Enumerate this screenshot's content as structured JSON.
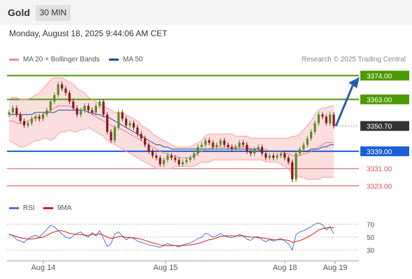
{
  "header": {
    "title": "Gold",
    "timeframe": "30 MIN"
  },
  "datetime": "Monday, August 18, 2025 9:44:06 AM CET",
  "legend": {
    "bollinger_label": "MA 20 + Bollinger Bands",
    "ma50_label": "MA 50",
    "credit": "Research © 2025 Trading Central"
  },
  "colors": {
    "resistance": "#4c9a00",
    "support": "#1a5fd6",
    "pivot_line": "#e05050",
    "last_price": "#333333",
    "bull_candle": "#5a8a2a",
    "bear_candle": "#8a1a1a",
    "bollinger": "#f8a0a0",
    "ma50": "#1f4e96",
    "arrow": "#2a5fb0",
    "rsi": "#4a73d9",
    "rsi_ma": "#d81b1b"
  },
  "chart_data": [
    {
      "type": "candlestick",
      "x_tick_labels": [
        "Aug 14",
        "Aug 15",
        "Aug 18",
        "Aug 19"
      ],
      "ylim": [
        3318,
        3378
      ],
      "levels": [
        {
          "label": "3374.00",
          "value": 3374.0,
          "kind": "resistance"
        },
        {
          "label": "3363.00",
          "value": 3363.0,
          "kind": "resistance"
        },
        {
          "label": "3350.70",
          "value": 3350.7,
          "kind": "last"
        },
        {
          "label": "3339.00",
          "value": 3339.0,
          "kind": "support"
        },
        {
          "label": "3331.00",
          "value": 3331.0,
          "kind": "pivot"
        },
        {
          "label": "3323.00",
          "value": 3323.0,
          "kind": "pivot"
        }
      ],
      "close": [
        3357,
        3359,
        3356,
        3353,
        3351,
        3352,
        3354,
        3355,
        3354,
        3356,
        3358,
        3362,
        3365,
        3370,
        3368,
        3366,
        3362,
        3359,
        3356,
        3358,
        3360,
        3358,
        3357,
        3360,
        3362,
        3356,
        3348,
        3344,
        3350,
        3357,
        3354,
        3351,
        3352,
        3350,
        3347,
        3345,
        3342,
        3339,
        3337,
        3336,
        3333,
        3335,
        3337,
        3336,
        3335,
        3333,
        3334,
        3335,
        3336,
        3338,
        3341,
        3342,
        3344,
        3343,
        3341,
        3342,
        3344,
        3342,
        3341,
        3340,
        3341,
        3343,
        3342,
        3339,
        3338,
        3340,
        3341,
        3338,
        3336,
        3337,
        3336,
        3337,
        3338,
        3336,
        3334,
        3326,
        3338,
        3340,
        3342,
        3345,
        3348,
        3352,
        3356,
        3355,
        3352,
        3356,
        3350.7
      ],
      "ma20": [
        3353,
        3353,
        3352,
        3352,
        3352,
        3353,
        3354,
        3355,
        3355,
        3356,
        3357,
        3358,
        3359,
        3360,
        3360,
        3360,
        3360,
        3359,
        3358,
        3358,
        3358,
        3357,
        3356,
        3355,
        3354,
        3353,
        3352,
        3351,
        3350,
        3350,
        3349,
        3348,
        3347,
        3346,
        3345,
        3344,
        3343,
        3342,
        3341,
        3340,
        3339,
        3338,
        3338,
        3337,
        3337,
        3336,
        3336,
        3336,
        3336,
        3337,
        3338,
        3339,
        3340,
        3340,
        3341,
        3341,
        3341,
        3341,
        3341,
        3341,
        3341,
        3341,
        3341,
        3341,
        3340,
        3340,
        3340,
        3340,
        3340,
        3339,
        3339,
        3339,
        3339,
        3338,
        3338,
        3337,
        3337,
        3337,
        3338,
        3338,
        3339,
        3340,
        3341,
        3342,
        3343,
        3343,
        3343
      ],
      "ma50": [
        3356,
        3356,
        3356,
        3356,
        3356,
        3356,
        3356,
        3357,
        3357,
        3357,
        3357,
        3357,
        3357,
        3358,
        3358,
        3358,
        3358,
        3358,
        3358,
        3358,
        3358,
        3357,
        3357,
        3356,
        3356,
        3355,
        3355,
        3354,
        3353,
        3352,
        3351,
        3350,
        3349,
        3348,
        3347,
        3346,
        3345,
        3344,
        3343,
        3342,
        3342,
        3341,
        3341,
        3340,
        3340,
        3340,
        3340,
        3340,
        3340,
        3340,
        3340,
        3340,
        3340,
        3340,
        3340,
        3340,
        3340,
        3340,
        3340,
        3340,
        3340,
        3340,
        3340,
        3340,
        3340,
        3340,
        3340,
        3339,
        3339,
        3339,
        3339,
        3339,
        3339,
        3339,
        3339,
        3339,
        3339,
        3339,
        3339,
        3339,
        3340,
        3340,
        3340,
        3341,
        3341,
        3342,
        3342
      ],
      "bb_upper": [
        3363,
        3364,
        3364,
        3363,
        3363,
        3363,
        3364,
        3365,
        3366,
        3368,
        3370,
        3372,
        3373,
        3373,
        3373,
        3372,
        3371,
        3370,
        3368,
        3367,
        3366,
        3364,
        3363,
        3362,
        3361,
        3360,
        3359,
        3358,
        3357,
        3357,
        3357,
        3356,
        3355,
        3354,
        3353,
        3351,
        3350,
        3349,
        3347,
        3346,
        3345,
        3344,
        3343,
        3342,
        3341,
        3341,
        3341,
        3341,
        3341,
        3342,
        3343,
        3344,
        3346,
        3347,
        3347,
        3347,
        3347,
        3347,
        3347,
        3347,
        3346,
        3346,
        3346,
        3346,
        3345,
        3345,
        3345,
        3345,
        3345,
        3345,
        3345,
        3345,
        3345,
        3345,
        3345,
        3346,
        3346,
        3347,
        3349,
        3351,
        3353,
        3356,
        3358,
        3359,
        3359,
        3360,
        3360
      ],
      "bb_lower": [
        3344,
        3343,
        3342,
        3341,
        3341,
        3342,
        3343,
        3344,
        3344,
        3345,
        3345,
        3344,
        3345,
        3347,
        3348,
        3348,
        3349,
        3348,
        3348,
        3349,
        3349,
        3350,
        3349,
        3348,
        3347,
        3346,
        3344,
        3343,
        3342,
        3341,
        3340,
        3339,
        3338,
        3337,
        3336,
        3335,
        3334,
        3333,
        3332,
        3331,
        3331,
        3331,
        3331,
        3331,
        3332,
        3332,
        3332,
        3332,
        3332,
        3332,
        3333,
        3334,
        3334,
        3334,
        3335,
        3335,
        3335,
        3335,
        3335,
        3335,
        3335,
        3335,
        3335,
        3335,
        3335,
        3335,
        3335,
        3335,
        3334,
        3334,
        3334,
        3334,
        3333,
        3332,
        3331,
        3328,
        3328,
        3327,
        3327,
        3326,
        3326,
        3326,
        3326,
        3327,
        3327,
        3327,
        3327
      ]
    },
    {
      "type": "line",
      "ylim": [
        20,
        80
      ],
      "y_tick_labels": [
        "70",
        "50",
        "30"
      ],
      "ref_levels": [
        70,
        50,
        30
      ],
      "series": [
        {
          "name": "RSI",
          "values": [
            55,
            52,
            46,
            44,
            42,
            47,
            51,
            53,
            50,
            56,
            62,
            68,
            66,
            60,
            55,
            50,
            48,
            52,
            56,
            58,
            53,
            50,
            57,
            52,
            60,
            48,
            36,
            40,
            55,
            58,
            52,
            46,
            50,
            48,
            44,
            42,
            40,
            38,
            37,
            36,
            34,
            38,
            40,
            38,
            37,
            35,
            38,
            40,
            41,
            44,
            48,
            50,
            56,
            54,
            50,
            52,
            56,
            52,
            50,
            49,
            51,
            54,
            52,
            47,
            45,
            50,
            51,
            46,
            43,
            46,
            44,
            46,
            48,
            44,
            40,
            30,
            54,
            58,
            60,
            63,
            66,
            70,
            72,
            69,
            61,
            66,
            55
          ]
        },
        {
          "name": "9MA",
          "values": [
            54,
            53,
            51,
            49,
            48,
            47,
            47,
            48,
            49,
            50,
            53,
            56,
            58,
            60,
            60,
            58,
            56,
            55,
            54,
            54,
            53,
            53,
            54,
            54,
            55,
            53,
            50,
            48,
            49,
            51,
            51,
            50,
            49,
            49,
            48,
            47,
            45,
            43,
            41,
            40,
            38,
            37,
            37,
            37,
            37,
            37,
            37,
            38,
            38,
            39,
            40,
            42,
            44,
            46,
            47,
            49,
            51,
            52,
            52,
            52,
            52,
            52,
            52,
            51,
            50,
            50,
            49,
            49,
            48,
            47,
            46,
            46,
            46,
            46,
            45,
            42,
            43,
            45,
            47,
            50,
            53,
            57,
            61,
            63,
            64,
            65,
            64
          ]
        }
      ]
    }
  ]
}
